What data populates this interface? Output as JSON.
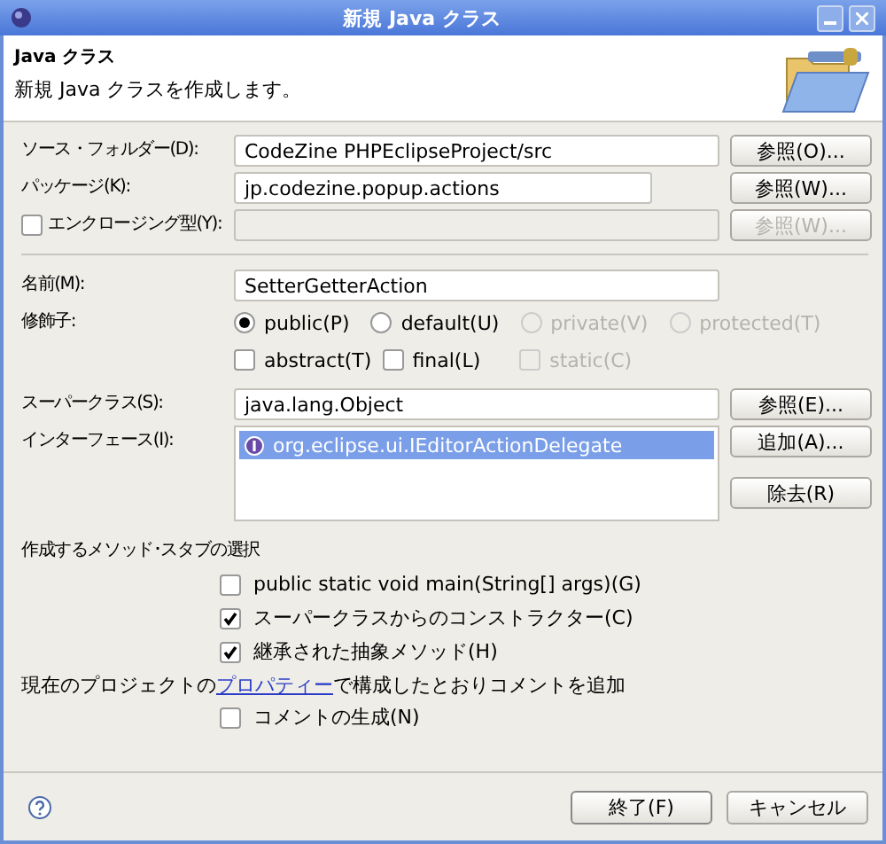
{
  "window": {
    "title": "新規 Java クラス"
  },
  "header": {
    "title": "Java クラス",
    "description": "新規 Java クラスを作成します。"
  },
  "location_fields": [
    {
      "kind": "text",
      "label": "ソース・フォルダー(D):",
      "value": "CodeZine PHPEclipseProject/src",
      "wide": true,
      "button": {
        "label": "参照(O)...",
        "disabled": false
      }
    },
    {
      "kind": "text",
      "label": "パッケージ(K):",
      "value": "jp.codezine.popup.actions",
      "wide": false,
      "button": {
        "label": "参照(W)...",
        "disabled": false
      }
    },
    {
      "kind": "checkbox_text",
      "label": "エンクロージング型(Y):",
      "checked": false,
      "wide": true,
      "button": {
        "label": "参照(W)...",
        "disabled": true
      }
    }
  ],
  "name": {
    "label": "名前(M):",
    "value": "SetterGetterAction"
  },
  "modifiers": {
    "label": "修飾子:",
    "access": [
      {
        "label": "public(P)",
        "selected": true,
        "disabled": false
      },
      {
        "label": "default(U)",
        "selected": false,
        "disabled": false
      },
      {
        "label": "private(V)",
        "selected": false,
        "disabled": true
      },
      {
        "label": "protected(T)",
        "selected": false,
        "disabled": true
      }
    ],
    "flags": [
      {
        "label": "abstract(T)",
        "checked": false,
        "disabled": false
      },
      {
        "label": "final(L)",
        "checked": false,
        "disabled": false
      },
      {
        "label": "static(C)",
        "checked": false,
        "disabled": true
      }
    ]
  },
  "superclass": {
    "label": "スーパークラス(S):",
    "value": "java.lang.Object",
    "button": {
      "label": "参照(E)..."
    }
  },
  "interfaces": {
    "label": "インターフェース(I):",
    "items": [
      {
        "label": "org.eclipse.ui.IEditorActionDelegate",
        "selected": true
      }
    ],
    "buttons": [
      {
        "label": "追加(A)..."
      },
      {
        "label": "除去(R)"
      }
    ]
  },
  "stubs": {
    "heading": "作成するメソッド･スタブの選択",
    "options": [
      {
        "label": "public static void main(String[] args)(G)",
        "checked": false
      },
      {
        "label": "スーパークラスからのコンストラクター(C)",
        "checked": true
      },
      {
        "label": "継承された抽象メソッド(H)",
        "checked": true
      }
    ]
  },
  "comments": {
    "text_before": "現在のプロジェクトの",
    "link": "プロパティー",
    "text_after": "で構成したとおりコメントを追加",
    "option": {
      "label": "コメントの生成(N)",
      "checked": false
    }
  },
  "footer": {
    "buttons": [
      {
        "label": "終了(F)",
        "default": true
      },
      {
        "label": "キャンセル",
        "default": false
      }
    ]
  }
}
